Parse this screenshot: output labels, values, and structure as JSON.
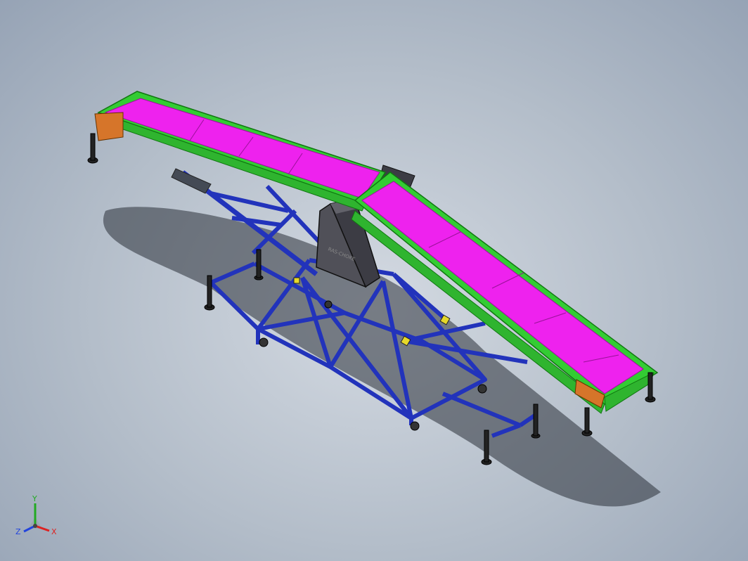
{
  "model": {
    "frame_label": "RAS-CHOKE",
    "colors": {
      "belt": "#ee22ee",
      "belt_frame": "#33cc33",
      "support_frame": "#2233bb",
      "motor_housing": "#3c3c44",
      "background": "#b3bdc9",
      "feet": "#222222",
      "joints": "#e6d82a"
    }
  },
  "triad": {
    "x_label": "X",
    "y_label": "Y",
    "z_label": "Z",
    "colors": {
      "x": "#dd2222",
      "y": "#22aa22",
      "z": "#2244dd"
    }
  }
}
